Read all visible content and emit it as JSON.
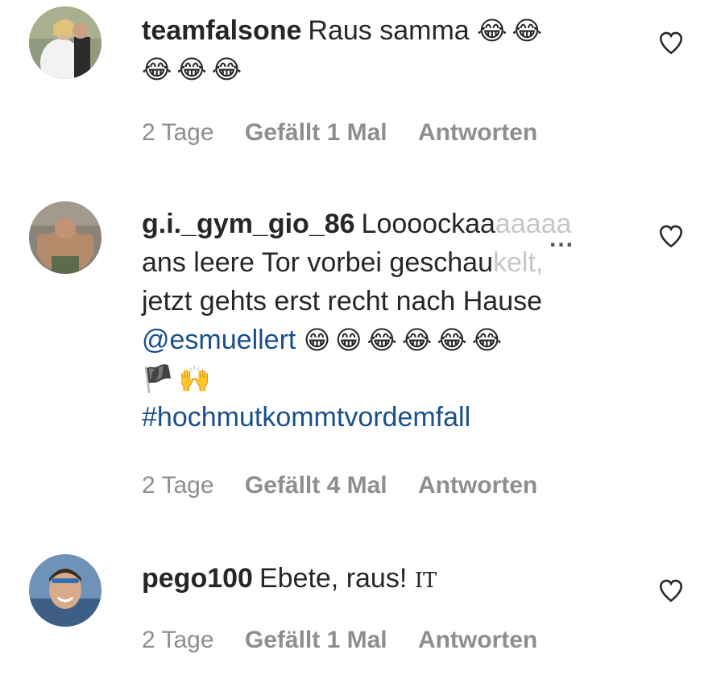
{
  "comments": [
    {
      "username": "teamfalsone",
      "text": "Raus samma",
      "emoji_line1": "😂😂",
      "emoji_line2": "😂😂😂",
      "time": "2 Tage",
      "likes": "Gefällt 1 Mal",
      "reply": "Antworten"
    },
    {
      "username": "g.i._gym_gio_86",
      "text_line1": "Loooockaa",
      "text_line1_faded": "aaaaa",
      "text_line2": "ans leere Tor vorbei geschau",
      "text_line2_faded": "kelt,",
      "text_line3": "jetzt gehts erst recht nach Hause",
      "mention": "@esmuellert",
      "emoji_line4": "😁😁😂😂😂😂",
      "emoji_line5": "🏴🙌",
      "hashtag": "#hochmutkommtvordemfall",
      "time": "2 Tage",
      "likes": "Gefällt 4 Mal",
      "reply": "Antworten",
      "more_menu": "..."
    },
    {
      "username": "pego100",
      "text": "Ebete, raus!",
      "flag_text": "IT",
      "time": "2 Tage",
      "likes": "Gefällt 1 Mal",
      "reply": "Antworten"
    }
  ],
  "icons": {
    "like": "heart-outline-icon",
    "more": "more-options-icon"
  },
  "colors": {
    "link": "#1a4f8b",
    "meta": "#8e8e8e",
    "text": "#262626"
  }
}
